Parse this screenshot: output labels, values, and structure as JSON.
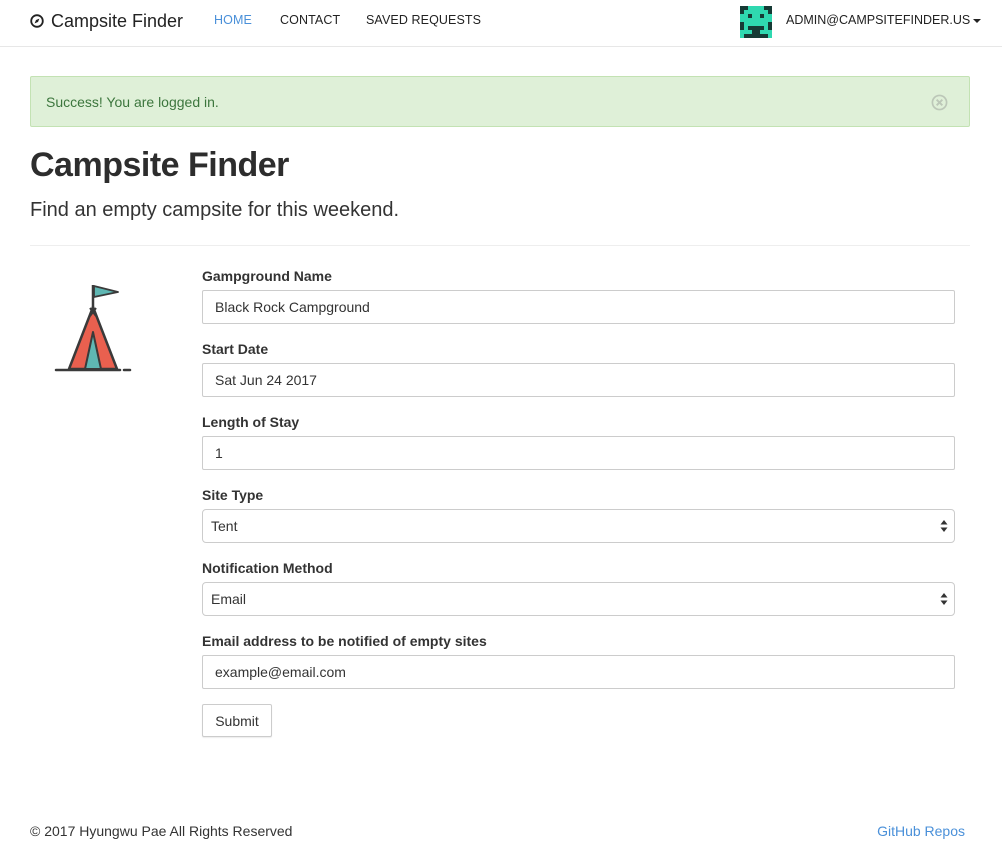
{
  "navbar": {
    "brand": "Campsite Finder",
    "brand_icon": "compass-icon",
    "links": [
      {
        "label": "HOME",
        "active": true
      },
      {
        "label": "CONTACT",
        "active": false
      },
      {
        "label": "SAVED REQUESTS",
        "active": false
      }
    ],
    "avatar_icon": "pixel-invader-avatar",
    "user_menu": "ADMIN@CAMPSITEFINDER.US"
  },
  "alert": {
    "message": "Success! You are logged in.",
    "close_icon": "circle-x-icon",
    "color": "#3c763d",
    "background": "#dff0d8"
  },
  "header": {
    "title": "Campsite Finder",
    "subtitle": "Find an empty campsite for this weekend."
  },
  "illustration": {
    "icon": "tent-with-flag-icon"
  },
  "form": {
    "campground_label": "Gampground Name",
    "campground_value": "Black Rock Campground",
    "start_date_label": "Start Date",
    "start_date_value": "Sat Jun 24 2017",
    "length_label": "Length of Stay",
    "length_value": "1",
    "site_type_label": "Site Type",
    "site_type_value": "Tent",
    "notification_label": "Notification Method",
    "notification_value": "Email",
    "email_label": "Email address to be notified of empty sites",
    "email_placeholder": "example@email.com",
    "submit_label": "Submit"
  },
  "footer": {
    "copyright": "© 2017 Hyungwu Pae All Rights Reserved",
    "link": "GitHub Repos"
  },
  "colors": {
    "link_active": "#4a90d9",
    "avatar_fg": "#2fd8b0",
    "avatar_bg": "#163a35"
  }
}
